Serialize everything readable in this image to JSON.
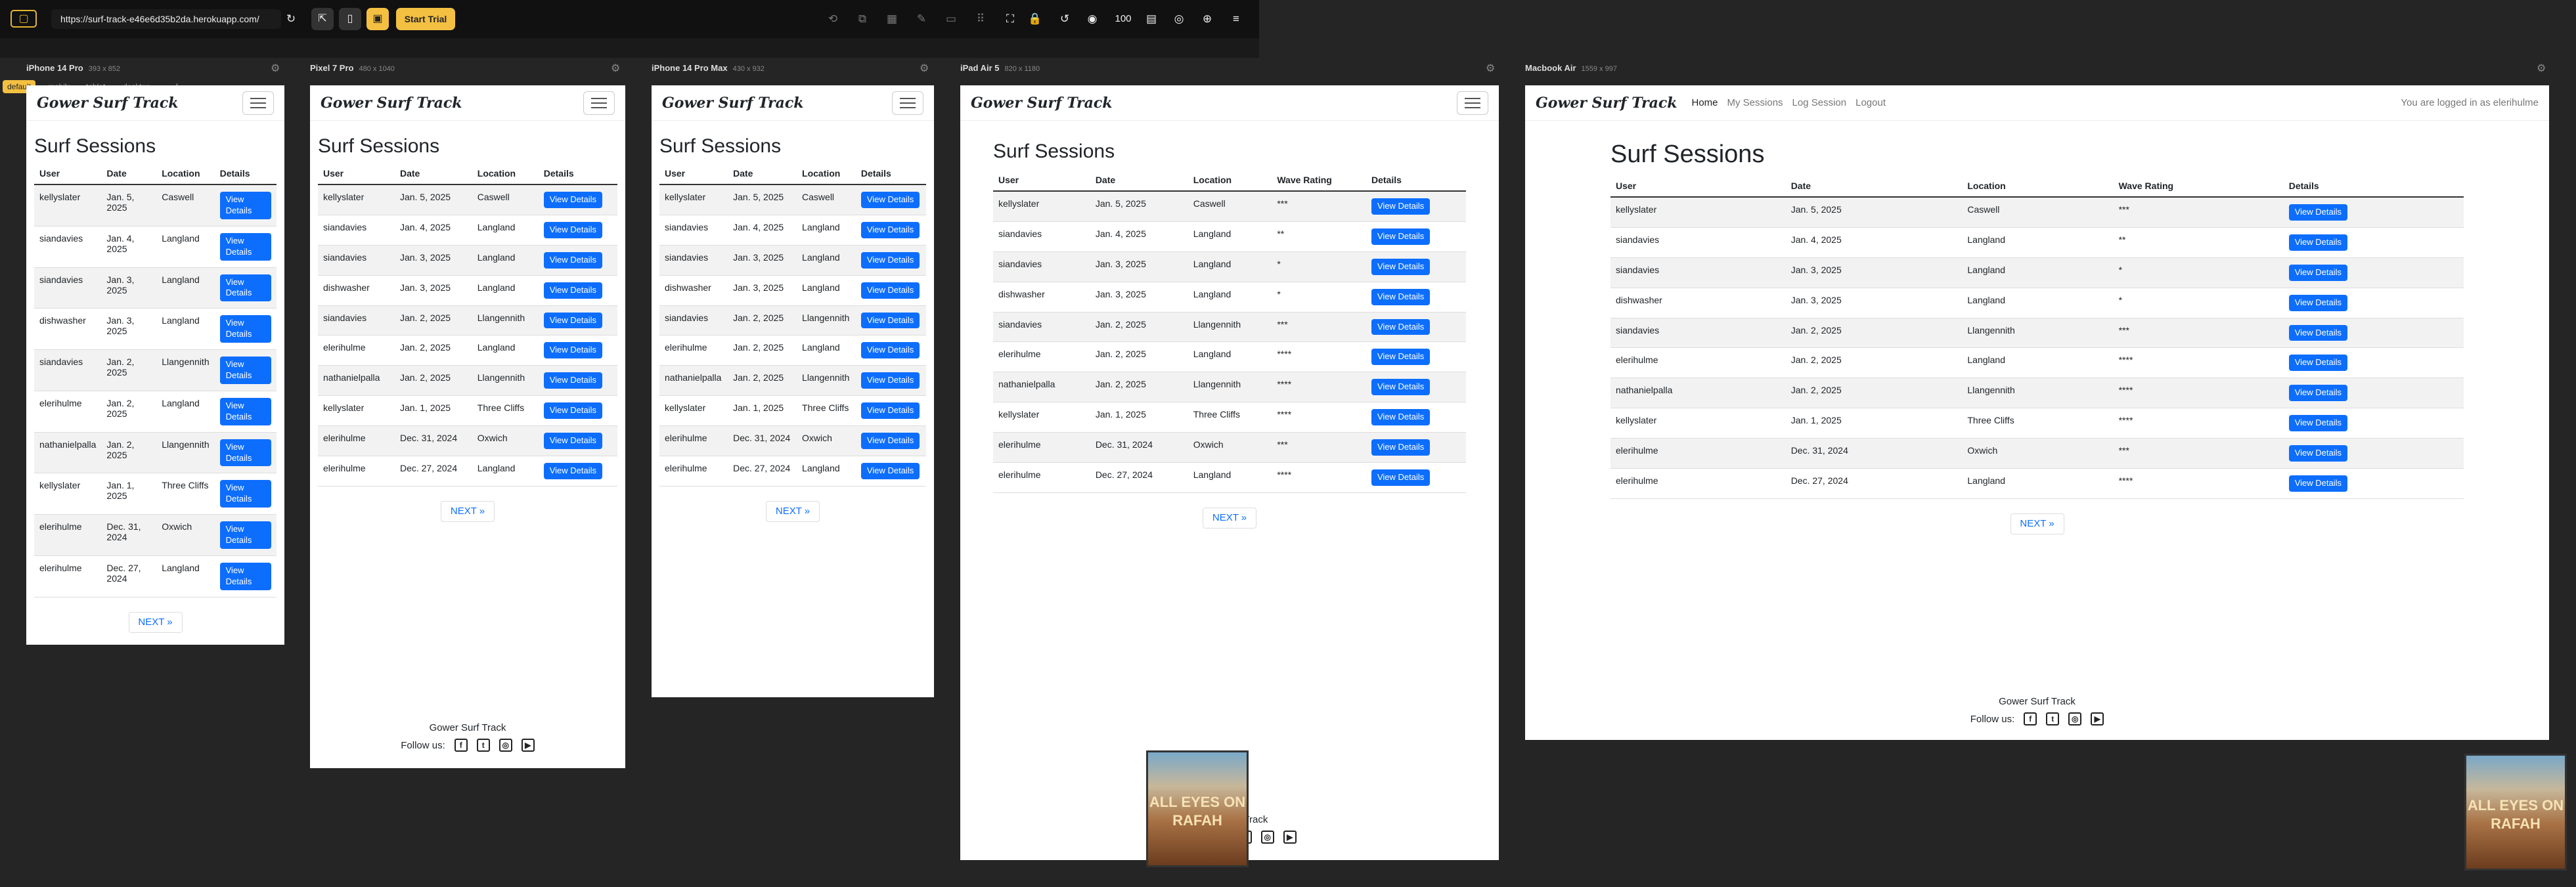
{
  "toolbar": {
    "url": "https://surf-track-e46e6d35b2da.herokuapp.com/",
    "zoom": "100",
    "trial": "Start Trial",
    "logo_icon": "layout-icon"
  },
  "tags": [
    "default",
    "mobile",
    "tablet",
    "desktop",
    "+"
  ],
  "devices": [
    {
      "name": "iPhone 14 Pro",
      "size": "393 x 852"
    },
    {
      "name": "Pixel 7 Pro",
      "size": "480 x 1040"
    },
    {
      "name": "iPhone 14 Pro Max",
      "size": "430 x 932"
    },
    {
      "name": "iPad Air 5",
      "size": "820 x 1180"
    },
    {
      "name": "Macbook Air",
      "size": "1559 x 997"
    }
  ],
  "site": {
    "brand": "Gower Surf Track",
    "heading": "Surf Sessions",
    "cols": [
      "User",
      "Date",
      "Location",
      "Wave Rating",
      "Details"
    ],
    "btn": "View Details",
    "next": "NEXT »",
    "footer": "Gower Surf Track",
    "follow": "Follow us:",
    "nav": [
      "Home",
      "My Sessions",
      "Log Session",
      "Logout"
    ],
    "logged": "You are logged in as elerihulme",
    "rows": [
      [
        "kellyslater",
        "Jan. 5, 2025",
        "Caswell",
        "***"
      ],
      [
        "siandavies",
        "Jan. 4, 2025",
        "Langland",
        "**"
      ],
      [
        "siandavies",
        "Jan. 3, 2025",
        "Langland",
        "*"
      ],
      [
        "dishwasher",
        "Jan. 3, 2025",
        "Langland",
        "*"
      ],
      [
        "siandavies",
        "Jan. 2, 2025",
        "Llangennith",
        "***"
      ],
      [
        "elerihulme",
        "Jan. 2, 2025",
        "Langland",
        "****"
      ],
      [
        "nathanielpalla",
        "Jan. 2, 2025",
        "Llangennith",
        "****"
      ],
      [
        "kellyslater",
        "Jan. 1, 2025",
        "Three Cliffs",
        "****"
      ],
      [
        "elerihulme",
        "Dec. 31, 2024",
        "Oxwich",
        "***"
      ],
      [
        "elerihulme",
        "Dec. 27, 2024",
        "Langland",
        "****"
      ]
    ]
  },
  "thumb_text": "ALL EYES ON RAFAH",
  "accent": "#0d6efd"
}
